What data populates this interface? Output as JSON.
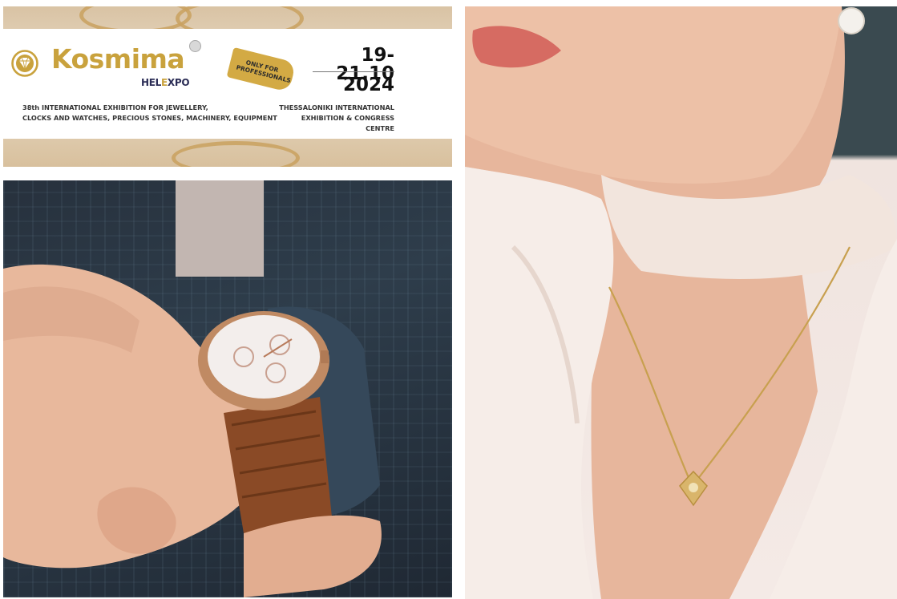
{
  "banner": {
    "brand": "Kosmima",
    "sub_brand_pre": "HEL",
    "sub_brand_mid": "E",
    "sub_brand_post": "XPO",
    "description_line1": "38th INTERNATIONAL EXHIBITION FOR JEWELLERY,",
    "description_line2": "CLOCKS AND WATCHES, PRECIOUS STONES, MACHINERY, EQUIPMENT",
    "tag_line1": "ONLY FOR",
    "tag_line2": "PROFESSIONALS",
    "date": "19-21.10",
    "year": "2024",
    "venue_line1": "THESSALONIKI INTERNATIONAL",
    "venue_line2": "EXHIBITION & CONGRESS CENTRE"
  },
  "colors": {
    "brand_gold": "#c9a23d",
    "helexpo_navy": "#2b2d56",
    "tag_gold": "#d3aa44"
  },
  "photos": {
    "left_bottom": "wristwatch-on-wrist",
    "right": "woman-gold-necklace"
  }
}
